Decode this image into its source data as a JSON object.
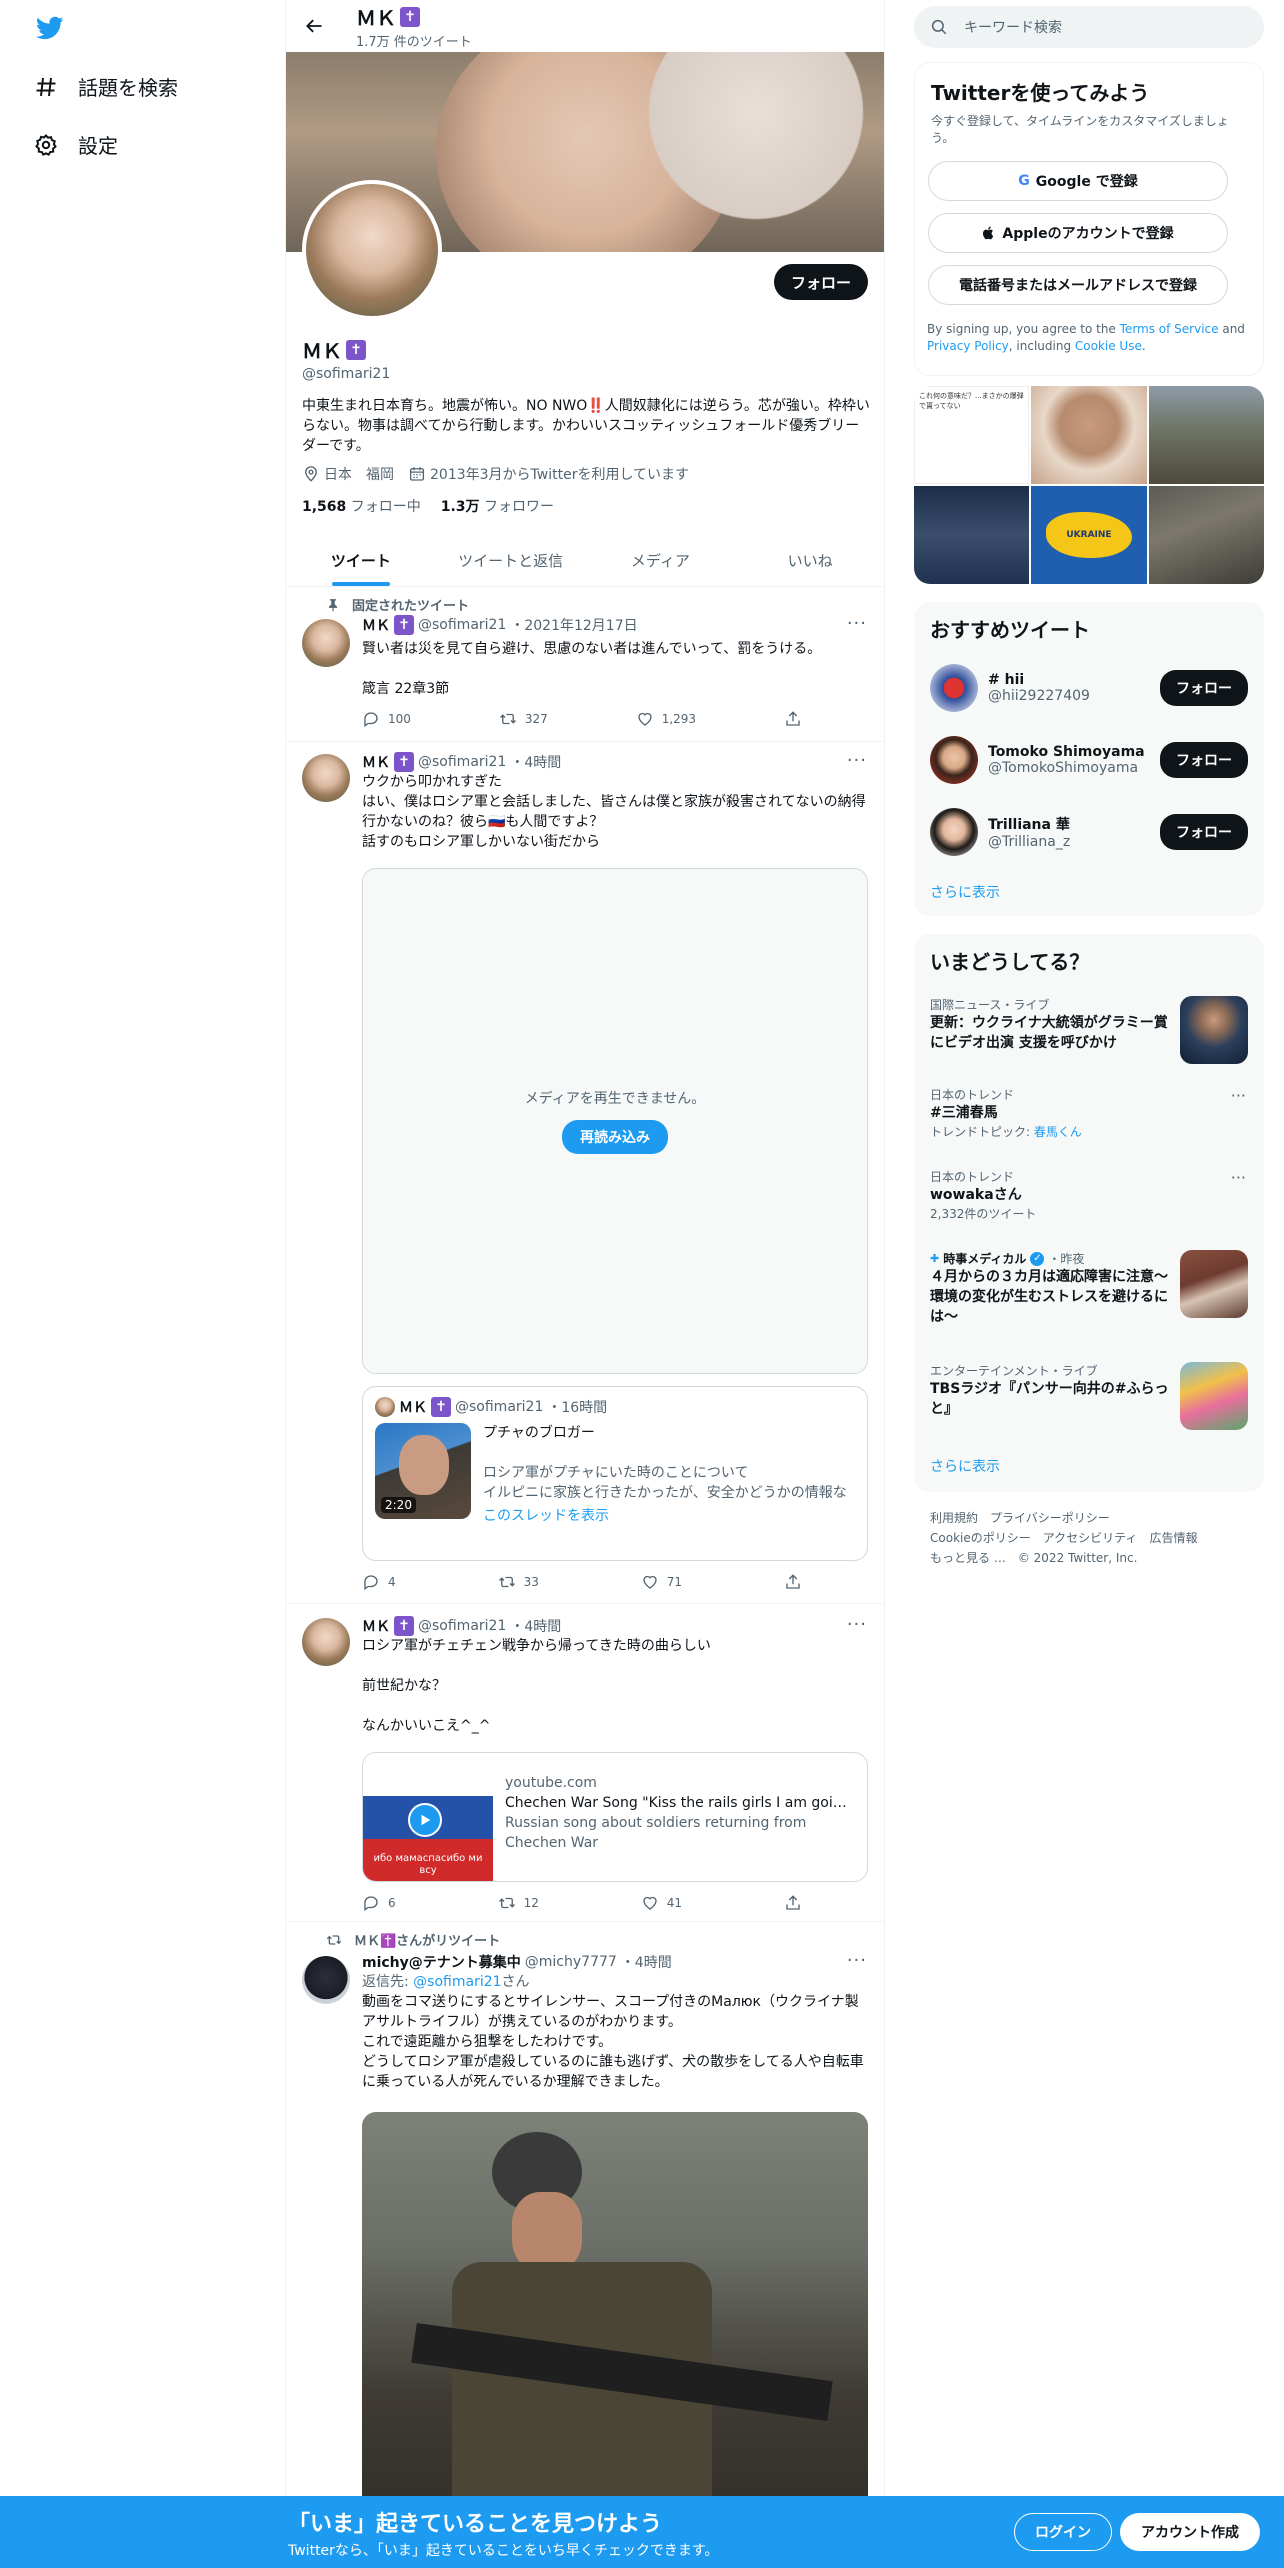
{
  "nav": {
    "explore_label": "話題を検索",
    "settings_label": "設定"
  },
  "header": {
    "name": "ＭＫ",
    "tweet_count": "1.7万 件のツイート"
  },
  "profile": {
    "follow_label": "フォロー",
    "name": "ＭＫ",
    "handle": "@sofimari21",
    "bio": "中東生まれ日本育ち。地震が怖い。NO NWO‼️人間奴隷化には逆らう。芯が強い。枠枠いらない。物事は調べてから行動します。かわいいスコッティッシュフォールド優秀ブリーダーです。",
    "location": "日本　福岡",
    "joined": "2013年3月からTwitterを利用しています",
    "following_count": "1,568",
    "following_label": "フォロー中",
    "followers_count": "1.3万",
    "followers_label": "フォロワー"
  },
  "tabs": [
    {
      "label": "ツイート"
    },
    {
      "label": "ツイートと返信"
    },
    {
      "label": "メディア"
    },
    {
      "label": "いいね"
    }
  ],
  "tweets": [
    {
      "pinned_label": "固定されたツイート",
      "name": "ＭＫ",
      "handle": "@sofimari21",
      "time": "・2021年12月17日",
      "text": "賢い者は災を見て自ら避け、思慮のない者は進んでいって、罰をうける。\n\n箴言 22章3節",
      "replies": "100",
      "retweets": "327",
      "likes": "1,293"
    },
    {
      "name": "ＭＫ",
      "handle": "@sofimari21",
      "time": "・4時間",
      "text": "ウクから叩かれすぎた\nはい、僕はロシア軍と会話しました、皆さんは僕と家族が殺害されてないの納得行かないのね？彼ら🇷🇺も人間ですよ？\n話すのもロシア軍しかいない街だから",
      "media_message": "メディアを再生できません。",
      "reload_label": "再読み込み",
      "quote": {
        "name": "ＭＫ",
        "handle": "@sofimari21",
        "time": "・16時間",
        "title": "プチャのブロガー",
        "text": "ロシア軍がプチャにいた時のことについて\nイルピニに家族と行きたかったが、安全かどうかの情報なく家の前で歩いてどうするか考えてた…",
        "duration": "2:20",
        "thread_link": "このスレッドを表示"
      },
      "replies": "4",
      "retweets": "33",
      "likes": "71"
    },
    {
      "name": "ＭＫ",
      "handle": "@sofimari21",
      "time": "・4時間",
      "text": "ロシア軍がチェチェン戦争から帰ってきた時の曲らしい\n\n前世紀かな？\n\nなんかいいこえ^_^",
      "card": {
        "domain": "youtube.com",
        "title": "Chechen War Song \"Kiss the rails girls I am going ...",
        "desc": "Russian song about soldiers returning from Chechen War",
        "overlay": "ибо мамаспасибо ми\nвсу"
      },
      "replies": "6",
      "retweets": "12",
      "likes": "41"
    },
    {
      "retweet_label": "ＭＫ✝️さんがリツイート",
      "name": "michy@テナント募集中",
      "handle": "@michy7777",
      "time": "・4時間",
      "reply_prefix": "返信先: ",
      "reply_handle": "@sofimari21",
      "reply_suffix": "さん",
      "text": "動画をコマ送りにするとサイレンサー、スコープ付きのMалюк（ウクライナ製アサルトライフル）が携えているのがわかります。\nこれで遠距離から狙撃をしたわけです。\nどうしてロシア軍が虐殺しているのに誰も逃げず、犬の散歩をしてる人や自転車に乗っている人が死んでいるか理解できました。"
    }
  ],
  "search": {
    "placeholder": "キーワード検索"
  },
  "signup": {
    "title": "Twitterを使ってみよう",
    "subtitle": "今すぐ登録して、タイムラインをカスタマイズしましょう。",
    "google": "Google で登録",
    "apple": "Appleのアカウントで登録",
    "phone": "電話番号またはメールアドレスで登録",
    "legal_1": "By signing up, you agree to the ",
    "tos": "Terms of Service",
    "legal_2": " and ",
    "privacy": "Privacy Policy",
    "legal_3": ", including ",
    "cookie": "Cookie Use",
    "legal_4": "."
  },
  "media_grid": {
    "map_label": "UKRAINE",
    "tweet_snip": "これ何の意味だ？...まさかの爆弾で貰ってない"
  },
  "recommended": {
    "title": "おすすめツイート",
    "items": [
      {
        "name": "# hii",
        "handle": "@hii29227409",
        "follow": "フォロー"
      },
      {
        "name": "Tomoko Shimoyama",
        "handle": "@TomokoShimoyama",
        "follow": "フォロー"
      },
      {
        "name": "Trilliana 華",
        "handle": "@Trilliana_z",
        "follow": "フォロー"
      }
    ],
    "more": "さらに表示"
  },
  "trends": {
    "title": "いまどうしてる？",
    "items": [
      {
        "category": "国際ニュース・ライブ",
        "title": "更新：ウクライナ大統領がグラミー賞にビデオ出演 支援を呼びかけ"
      },
      {
        "category": "日本のトレンド",
        "title": "#三浦春馬",
        "sub_prefix": "トレンドトピック: ",
        "sub_link": "春馬くん"
      },
      {
        "category": "日本のトレンド",
        "title": "wowakaさん",
        "sub": "2,332件のツイート"
      },
      {
        "source": "時事メディカル",
        "time": "・昨夜",
        "title": "４月からの３カ月は適応障害に注意～環境の変化が生むストレスを避けるには～"
      },
      {
        "category": "エンターテインメント・ライブ",
        "title": "TBSラジオ『パンサー向井の#ふらっと』"
      }
    ],
    "more": "さらに表示"
  },
  "footer": {
    "terms": "利用規約",
    "privacy": "プライバシーポリシー",
    "cookie": "Cookieのポリシー",
    "accessibility": "アクセシビリティ",
    "ads": "広告情報",
    "more": "もっと見る …",
    "copyright": "© 2022 Twitter, Inc."
  },
  "bottom_bar": {
    "title": "「いま」起きていることを見つけよう",
    "subtitle": "Twitterなら、「いま」起きていることをいち早くチェックできます。",
    "login": "ログイン",
    "signup": "アカウント作成"
  },
  "colors": {
    "accent": "#1d9bf0",
    "text": "#0f1419",
    "muted": "#536471",
    "cross_badge": "#7b55c9"
  }
}
